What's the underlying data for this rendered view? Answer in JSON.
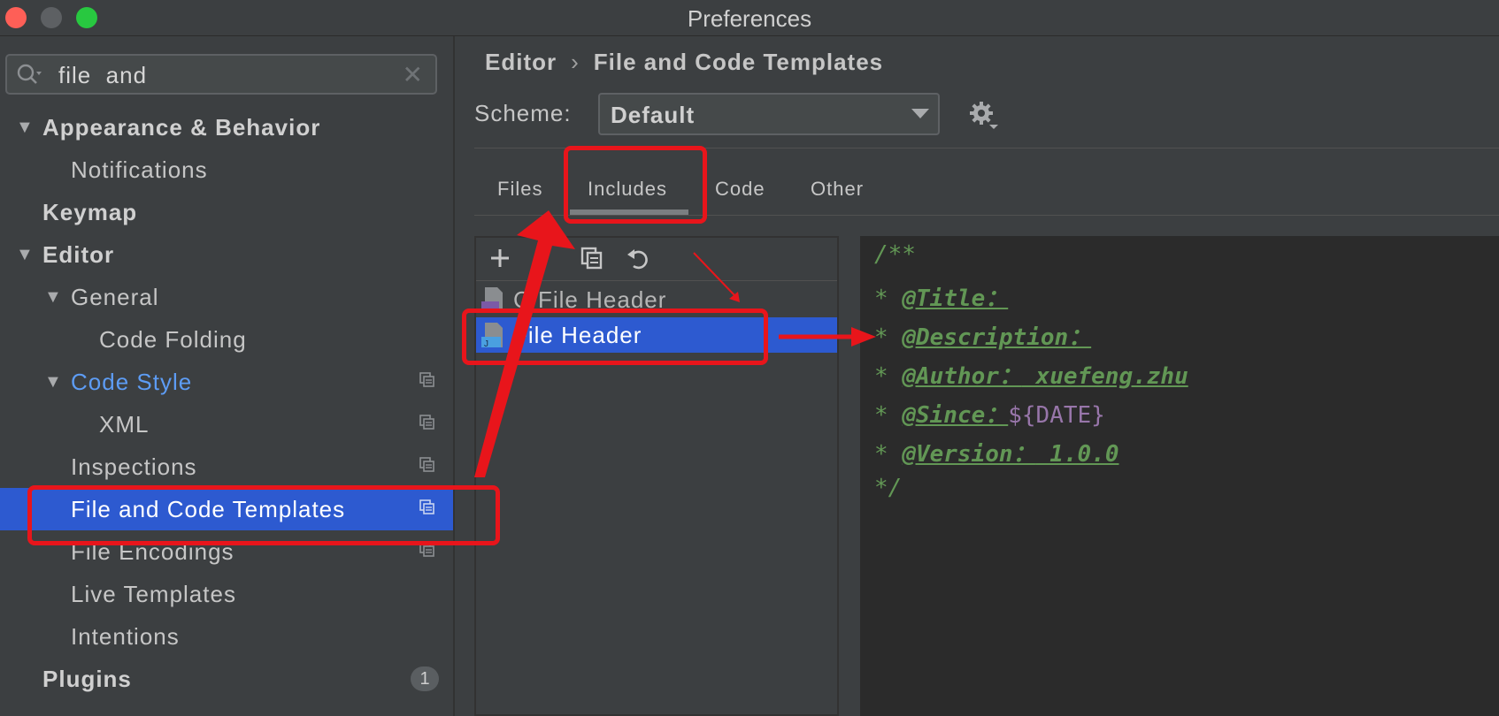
{
  "window": {
    "title": "Preferences"
  },
  "search": {
    "value": "file  and"
  },
  "sidebar": {
    "items": [
      {
        "label": "Appearance & Behavior"
      },
      {
        "label": "Notifications"
      },
      {
        "label": "Keymap"
      },
      {
        "label": "Editor"
      },
      {
        "label": "General"
      },
      {
        "label": "Code Folding"
      },
      {
        "label": "Code Style"
      },
      {
        "label": "XML"
      },
      {
        "label": "Inspections"
      },
      {
        "label": "File and Code Templates"
      },
      {
        "label": "File Encodings"
      },
      {
        "label": "Live Templates"
      },
      {
        "label": "Intentions"
      },
      {
        "label": "Plugins",
        "badge": "1"
      }
    ]
  },
  "breadcrumb": {
    "parent": "Editor",
    "separator": "›",
    "current": "File and Code Templates"
  },
  "scheme": {
    "label": "Scheme:",
    "value": "Default"
  },
  "tabs": [
    {
      "label": "Files"
    },
    {
      "label": "Includes",
      "active": true
    },
    {
      "label": "Code"
    },
    {
      "label": "Other"
    }
  ],
  "templates": {
    "items": [
      {
        "name": "C File Header"
      },
      {
        "name": "File Header",
        "selected": true
      }
    ]
  },
  "editor": {
    "lines": [
      {
        "text": "/**"
      },
      {
        "prefix": "* ",
        "tag": "@Title：",
        "value": ""
      },
      {
        "prefix": "* ",
        "tag": "@Description：",
        "value": ""
      },
      {
        "prefix": "* ",
        "tag": "@Author：",
        "value": " xuefeng.zhu"
      },
      {
        "prefix": "* ",
        "tag": "@Since：",
        "var": "${DATE}"
      },
      {
        "prefix": "* ",
        "tag": "@Version：",
        "value": " 1.0.0"
      },
      {
        "text": "*/"
      }
    ]
  },
  "colors": {
    "selection": "#2d5ad0",
    "annotation": "#e8151b",
    "comment": "#629755",
    "variable": "#9876aa"
  }
}
